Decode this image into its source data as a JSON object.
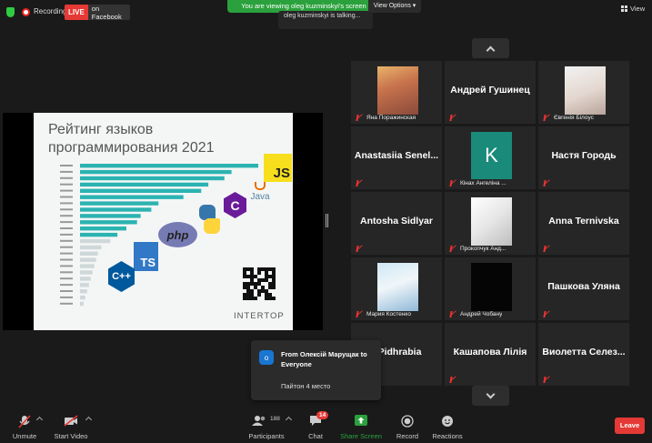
{
  "top_bar": {
    "recording_label": "Recording",
    "live_label": "LIVE",
    "live_target": "on Facebook",
    "viewing_banner": "You are viewing oleg kuzminskyi's screen",
    "talking_text": "oleg kuzminskyi is talking...",
    "view_options_label": "View Options",
    "view_label": "View"
  },
  "slide": {
    "title_line1": "Рейтинг языков",
    "title_line2": "программирования 2021",
    "brand": "INTERTOP",
    "logos": {
      "js": "JS",
      "java": "Java",
      "c": "C",
      "php": "php",
      "ts": "TS",
      "cpp": "C++"
    },
    "bar_color": "#2bb3b1",
    "bar_values": [
      100,
      85,
      81,
      72,
      68,
      58,
      44,
      40,
      34,
      32,
      26,
      21,
      17,
      12,
      10,
      9,
      8,
      7,
      6,
      5,
      4,
      3,
      2
    ]
  },
  "gallery": {
    "tiles": [
      {
        "big": "",
        "small": "Яна Поражинская",
        "photo": "girl-flowers"
      },
      {
        "big": "Андрей Гушинец",
        "small": ""
      },
      {
        "big": "",
        "small": "Євгенія Білоус",
        "photo": "girl-light"
      },
      {
        "big": "Anastasiia  Senel...",
        "small": ""
      },
      {
        "big": "",
        "small": "Кінах Ангеліна ...",
        "avatar": "K"
      },
      {
        "big": "Настя Городь",
        "small": ""
      },
      {
        "big": "Antosha Sidlyar",
        "small": ""
      },
      {
        "big": "",
        "small": "Прокопчук Анд...",
        "photo": "sketch"
      },
      {
        "big": "Anna Ternivska",
        "small": ""
      },
      {
        "big": "",
        "small": "Мария Костенко",
        "photo": "girl-blue"
      },
      {
        "big": "",
        "small": "Андрей Чобану",
        "photo": "dark"
      },
      {
        "big": "Пашкова Уляна",
        "small": ""
      },
      {
        "big": "r Pidhrabia",
        "small": ""
      },
      {
        "big": "Кашапова Лілія",
        "small": ""
      },
      {
        "big": "Виолетта  Селез...",
        "small": ""
      }
    ]
  },
  "chat_popup": {
    "avatar_letter": "o",
    "from_text": "From Олексій Марущак to Everyone",
    "message": "Пайтон 4 место"
  },
  "toolbar": {
    "unmute": "Unmute",
    "start_video": "Start Video",
    "participants": "Participants",
    "participants_count": "188",
    "chat": "Chat",
    "chat_badge": "14",
    "share_screen": "Share Screen",
    "record": "Record",
    "reactions": "Reactions",
    "leave": "Leave"
  },
  "colors": {
    "share_green": "#2aa13c",
    "leave_red": "#e53935",
    "tile_bg": "#262626"
  }
}
